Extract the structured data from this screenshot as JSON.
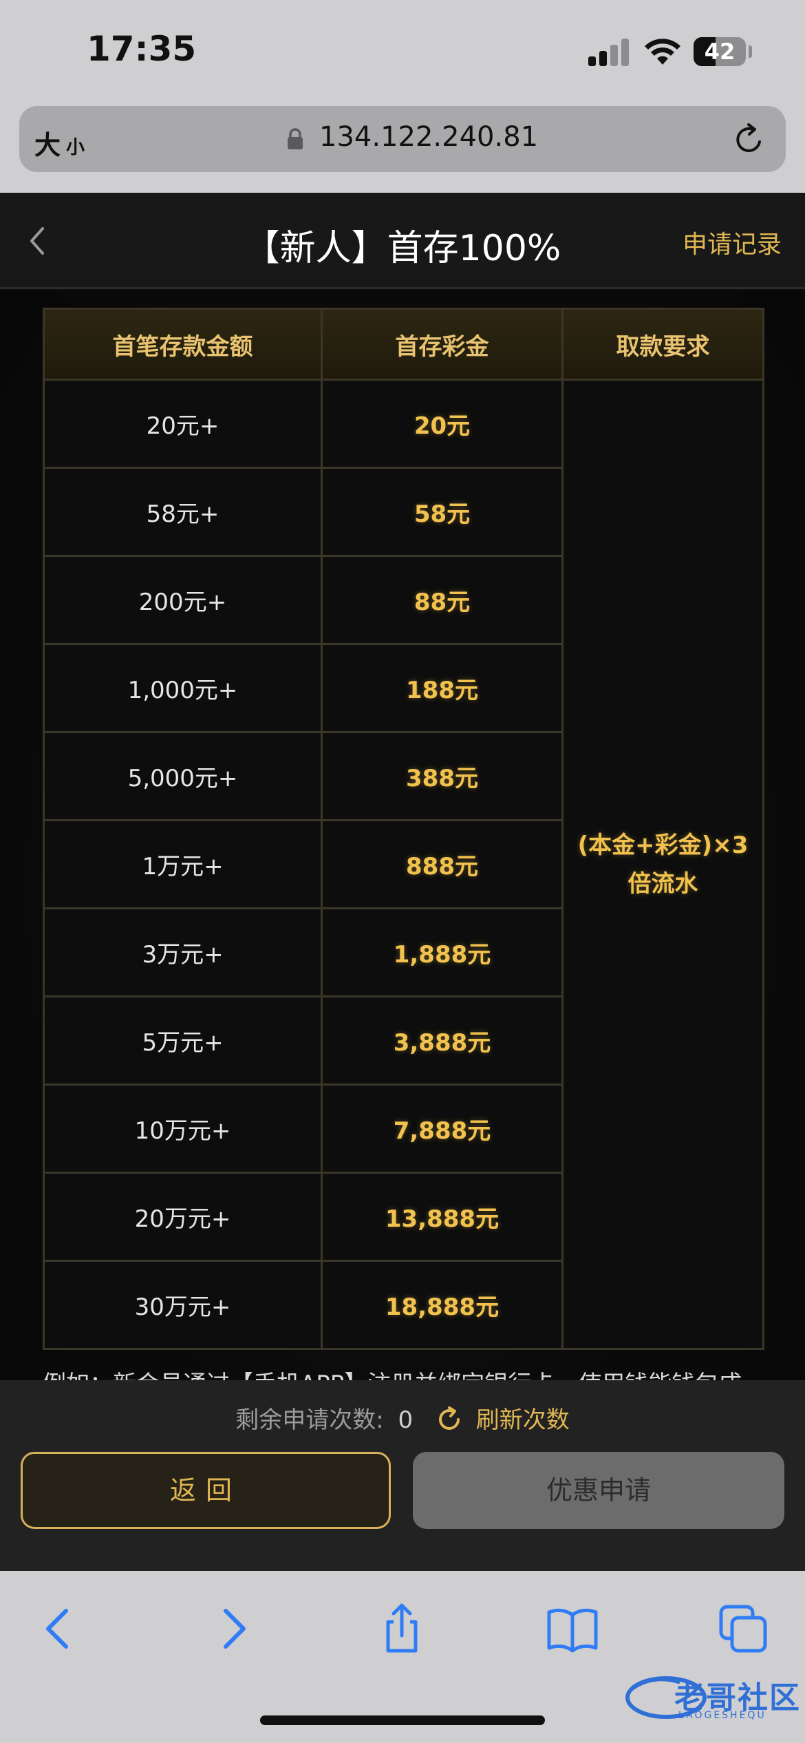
{
  "status_bar": {
    "time": "17:35",
    "battery": "42",
    "battery_fraction": 0.42
  },
  "address_bar": {
    "text_size_big": "大",
    "text_size_small": "小",
    "url": "134.122.240.81"
  },
  "header": {
    "title": "【新人】首存100%",
    "apply_record": "申请记录"
  },
  "table": {
    "headers": [
      "首笔存款金额",
      "首存彩金",
      "取款要求"
    ],
    "rows": [
      {
        "deposit": "20元+",
        "bonus": "20元"
      },
      {
        "deposit": "58元+",
        "bonus": "58元"
      },
      {
        "deposit": "200元+",
        "bonus": "88元"
      },
      {
        "deposit": "1,000元+",
        "bonus": "188元"
      },
      {
        "deposit": "5,000元+",
        "bonus": "388元"
      },
      {
        "deposit": "1万元+",
        "bonus": "888元"
      },
      {
        "deposit": "3万元+",
        "bonus": "1,888元"
      },
      {
        "deposit": "5万元+",
        "bonus": "3,888元"
      },
      {
        "deposit": "10万元+",
        "bonus": "7,888元"
      },
      {
        "deposit": "20万元+",
        "bonus": "13,888元"
      },
      {
        "deposit": "30万元+",
        "bonus": "18,888元"
      }
    ],
    "requirement_line1": "(本金+彩金)×3",
    "requirement_line2": "倍流水"
  },
  "description": "例如：新会员通过【手机APP】注册并绑定银行卡，使用钱能钱包成",
  "actions": {
    "remaining_label": "剩余申请次数:",
    "remaining_count": "0",
    "refresh_label": "刷新次数",
    "return_label": "返回",
    "promo_label": "优惠申请"
  },
  "watermark": {
    "text": "老哥社区",
    "sub": "LAOGESHEQU"
  },
  "colors": {
    "accent_gold": "#e0b653",
    "bonus_gold": "#f2c24e",
    "safari_blue": "#2f7cf6"
  }
}
